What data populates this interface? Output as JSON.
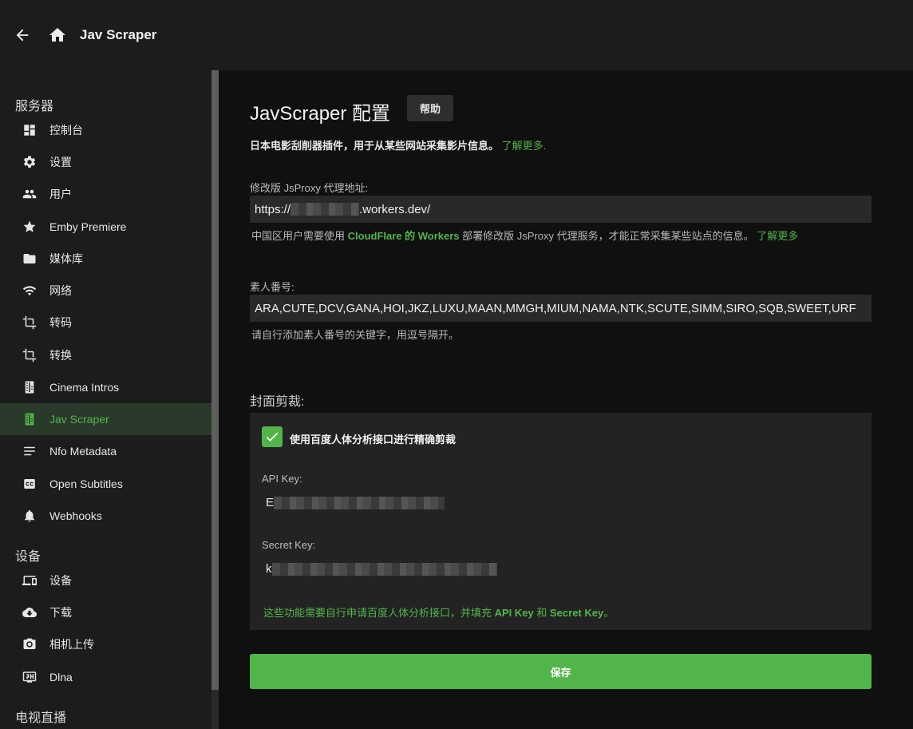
{
  "header": {
    "title": "Jav Scraper"
  },
  "sidebar": {
    "sections": [
      {
        "title": "服务器"
      },
      {
        "title": "设备"
      },
      {
        "title": "电视直播"
      }
    ],
    "server_items": [
      {
        "label": "控制台",
        "icon": "dashboard-icon"
      },
      {
        "label": "设置",
        "icon": "gear-icon"
      },
      {
        "label": "用户",
        "icon": "people-icon"
      },
      {
        "label": "Emby Premiere",
        "icon": "star-icon"
      },
      {
        "label": "媒体库",
        "icon": "folder-icon"
      },
      {
        "label": "网络",
        "icon": "wifi-icon"
      },
      {
        "label": "转码",
        "icon": "crop-icon"
      },
      {
        "label": "转换",
        "icon": "crop-icon"
      },
      {
        "label": "Cinema Intros",
        "icon": "film-icon"
      },
      {
        "label": "Jav Scraper",
        "icon": "film-icon",
        "active": true
      },
      {
        "label": "Nfo Metadata",
        "icon": "lines-icon"
      },
      {
        "label": "Open Subtitles",
        "icon": "cc-icon"
      },
      {
        "label": "Webhooks",
        "icon": "bell-icon"
      }
    ],
    "device_items": [
      {
        "label": "设备",
        "icon": "devices-icon"
      },
      {
        "label": "下载",
        "icon": "cloud-download-icon"
      },
      {
        "label": "相机上传",
        "icon": "camera-icon"
      },
      {
        "label": "Dlna",
        "icon": "screen-icon"
      }
    ]
  },
  "main": {
    "title": "JavScraper 配置",
    "help_label": "帮助",
    "description": "日本电影刮削器插件，用于从某些网站采集影片信息。",
    "description_link": "了解更多.",
    "proxy": {
      "label": "修改版 JsProxy 代理地址:",
      "value_prefix": "https://",
      "value_suffix": ".workers.dev/",
      "hint_prefix": "中国区用户需要使用 ",
      "hint_green": "CloudFlare 的 Workers",
      "hint_middle": " 部署修改版 JsProxy 代理服务，才能正常采集某些站点的信息。 ",
      "hint_link": "了解更多"
    },
    "amateur": {
      "label": "素人番号:",
      "value": "ARA,CUTE,DCV,GANA,HOI,JKZ,LUXU,MAAN,MMGH,MIUM,NAMA,NTK,SCUTE,SIMM,SIRO,SQB,SWEET,URF",
      "hint": "请自行添加素人番号的关键字，用逗号隔开。"
    },
    "cover": {
      "title": "封面剪裁:",
      "checkbox_label": "使用百度人体分析接口进行精确剪裁",
      "checked": true,
      "api_key_label": "API Key:",
      "api_key_first_char": "E",
      "secret_key_label": "Secret Key:",
      "secret_key_first_char": "k",
      "note_prefix": "这些功能需要自行申请百度人体分析接口，并填充 ",
      "note_api": "API Key",
      "note_and": " 和 ",
      "note_secret": "Secret Key",
      "note_suffix": "。"
    },
    "save_label": "保存"
  },
  "colors": {
    "accent": "#52b54b",
    "header_bg": "#1c1c1c",
    "sidebar_bg": "#1c1c1c",
    "main_bg": "#101010"
  }
}
